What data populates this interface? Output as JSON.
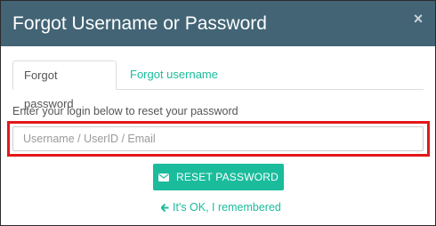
{
  "modal": {
    "title": "Forgot Username or Password",
    "close_icon": "×"
  },
  "tabs": [
    {
      "label": "Forgot password",
      "active": true
    },
    {
      "label": "Forgot username",
      "active": false
    }
  ],
  "form": {
    "instruction": "Enter your login below to reset your password",
    "login_input": {
      "value": "",
      "placeholder": "Username / UserID / Email"
    },
    "reset_button": {
      "label": "RESET PASSWORD",
      "icon": "envelope-icon"
    },
    "back_link": {
      "label": "It's OK, I remembered",
      "icon": "arrow-left-icon"
    }
  },
  "colors": {
    "header": "#426475",
    "accent": "#1abc9c",
    "highlight": "#e31818"
  }
}
